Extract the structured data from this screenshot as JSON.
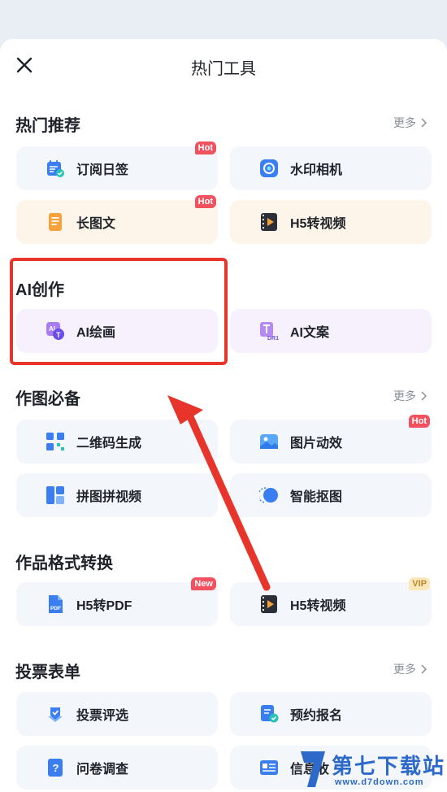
{
  "header": {
    "title": "热门工具"
  },
  "sections": {
    "hot": {
      "title": "热门推荐",
      "more": "更多",
      "items": [
        {
          "label": "订阅日签",
          "icon": "calendar-check-icon",
          "badge": "Hot"
        },
        {
          "label": "水印相机",
          "icon": "camera-icon",
          "badge": ""
        },
        {
          "label": "长图文",
          "icon": "long-document-icon",
          "badge": "Hot"
        },
        {
          "label": "H5转视频",
          "icon": "video-film-icon",
          "badge": ""
        }
      ]
    },
    "ai": {
      "title": "AI创作",
      "items": [
        {
          "label": "AI绘画",
          "icon": "ai-paint-icon",
          "badge": ""
        },
        {
          "label": "AI文案",
          "icon": "ai-text-icon",
          "badge": ""
        }
      ]
    },
    "design": {
      "title": "作图必备",
      "more": "更多",
      "items": [
        {
          "label": "二维码生成",
          "icon": "qrcode-icon",
          "badge": ""
        },
        {
          "label": "图片动效",
          "icon": "image-motion-icon",
          "badge": "Hot"
        },
        {
          "label": "拼图拼视频",
          "icon": "collage-icon",
          "badge": ""
        },
        {
          "label": "智能抠图",
          "icon": "cutout-icon",
          "badge": ""
        }
      ]
    },
    "convert": {
      "title": "作品格式转换",
      "items": [
        {
          "label": "H5转PDF",
          "icon": "pdf-icon",
          "badge": "New"
        },
        {
          "label": "H5转视频",
          "icon": "video-film-icon",
          "badge": "VIP"
        }
      ]
    },
    "vote": {
      "title": "投票表单",
      "more": "更多",
      "items": [
        {
          "label": "投票评选",
          "icon": "vote-icon",
          "badge": ""
        },
        {
          "label": "预约报名",
          "icon": "signup-icon",
          "badge": ""
        },
        {
          "label": "问卷调查",
          "icon": "survey-icon",
          "badge": ""
        },
        {
          "label": "信息收",
          "icon": "form-collect-icon",
          "badge": ""
        }
      ]
    }
  },
  "watermark": {
    "name": "第七下载站",
    "url": "www.d7down.com"
  },
  "colors": {
    "accent": "#3a7ef2",
    "hot_badge": "#f2515f",
    "highlight": "#e8352c"
  }
}
